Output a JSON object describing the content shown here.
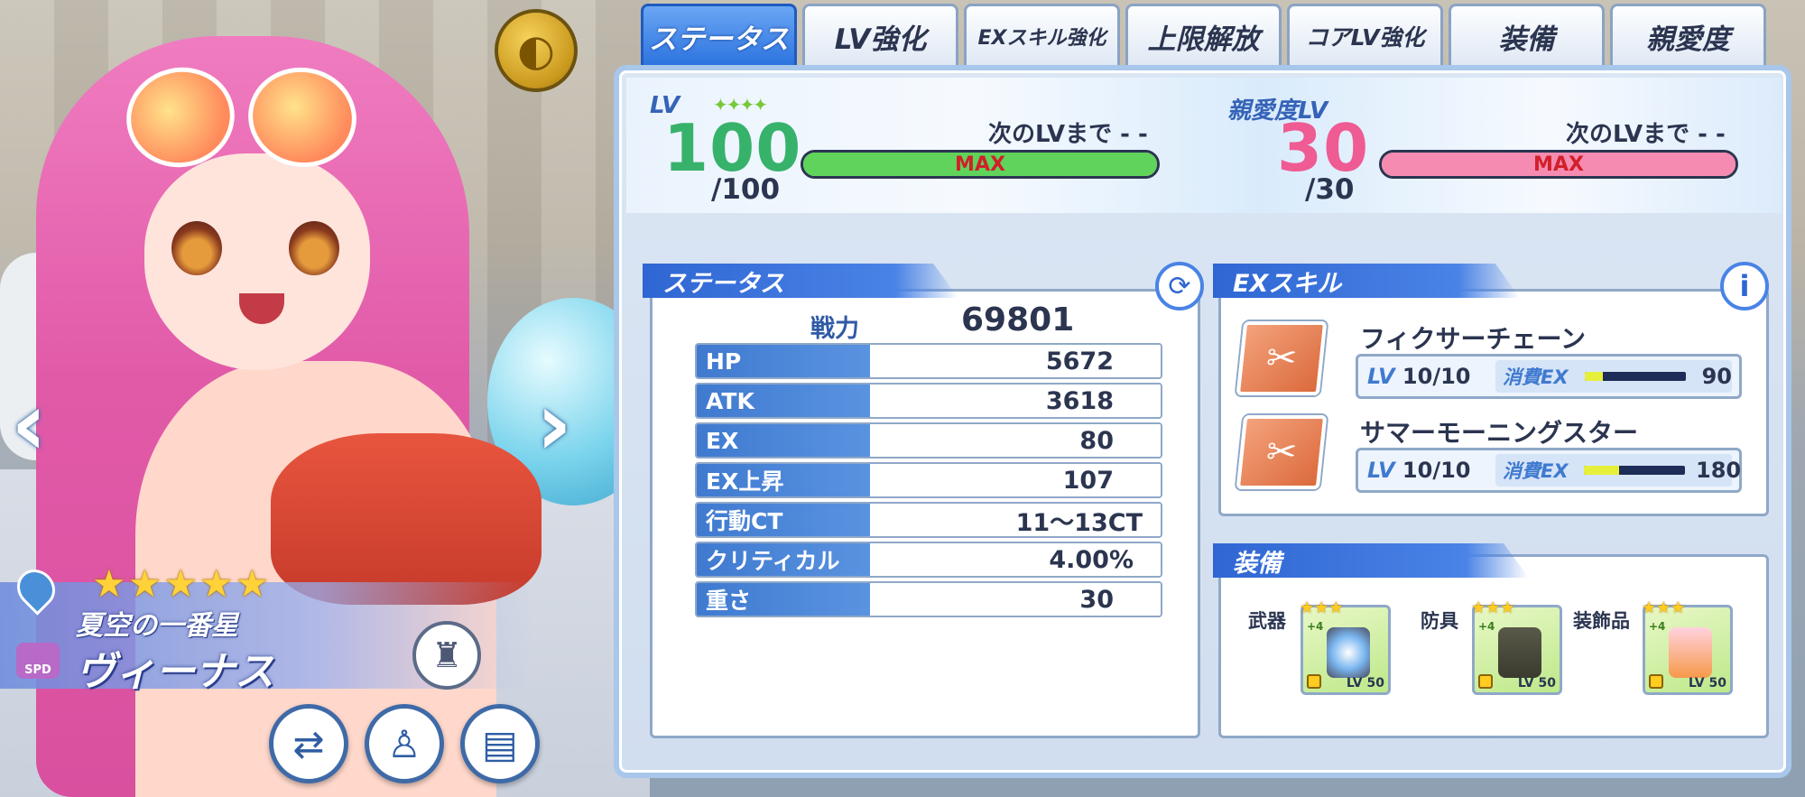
{
  "tabs": [
    {
      "label": "ステータス",
      "active": true
    },
    {
      "label": "LV強化",
      "active": false
    },
    {
      "label": "EXスキル強化",
      "active": false
    },
    {
      "label": "上限解放",
      "active": false
    },
    {
      "label": "コアLV強化",
      "active": false
    },
    {
      "label": "装備",
      "active": false
    },
    {
      "label": "親愛度",
      "active": false
    }
  ],
  "character": {
    "title": "夏空の一番星",
    "name": "ヴィーナス",
    "rarity_stars": 5,
    "class_badge": "SPD",
    "element_icon": "water-drop-icon",
    "faction_icon": "shield-emblem-icon"
  },
  "level": {
    "label": "LV",
    "value": "100",
    "max": "/100",
    "next_label": "次のLVまで - -",
    "bar_text": "MAX",
    "bar_fill": 1.0,
    "bar_color": "#5fd35a"
  },
  "affection": {
    "label": "親愛度LV",
    "value": "30",
    "max": "/30",
    "next_label": "次のLVまで - -",
    "bar_text": "MAX",
    "bar_fill": 1.0,
    "bar_color": "#f58bb0"
  },
  "status": {
    "header": "ステータス",
    "power_label": "戦力",
    "power_value": "69801",
    "rows": [
      {
        "key": "HP",
        "value": "5672"
      },
      {
        "key": "ATK",
        "value": "3618"
      },
      {
        "key": "EX",
        "value": "80"
      },
      {
        "key": "EX上昇",
        "value": "107"
      },
      {
        "key": "行動CT",
        "value": "11～13CT"
      },
      {
        "key": "クリティカル",
        "value": "4.00%"
      },
      {
        "key": "重さ",
        "value": "30"
      }
    ]
  },
  "ex_skills": {
    "header": "EXスキル",
    "cost_label": "消費EX",
    "items": [
      {
        "name": "フィクサーチェーン",
        "lv": "10/10",
        "cost": "90",
        "cost_fill": 0.18
      },
      {
        "name": "サマーモーニングスター",
        "lv": "10/10",
        "cost": "180",
        "cost_fill": 0.35
      }
    ]
  },
  "equipment": {
    "header": "装備",
    "slots": [
      {
        "label": "武器",
        "level": "LV 50",
        "plus": "+4"
      },
      {
        "label": "防具",
        "level": "LV 50",
        "plus": "+4"
      },
      {
        "label": "装飾品",
        "level": "LV 50",
        "plus": "+4"
      }
    ]
  },
  "lv_prefix": "LV",
  "colors": {
    "accent": "#2f66d3",
    "level_number": "#37b26b",
    "affection_number": "#ef5b93"
  }
}
